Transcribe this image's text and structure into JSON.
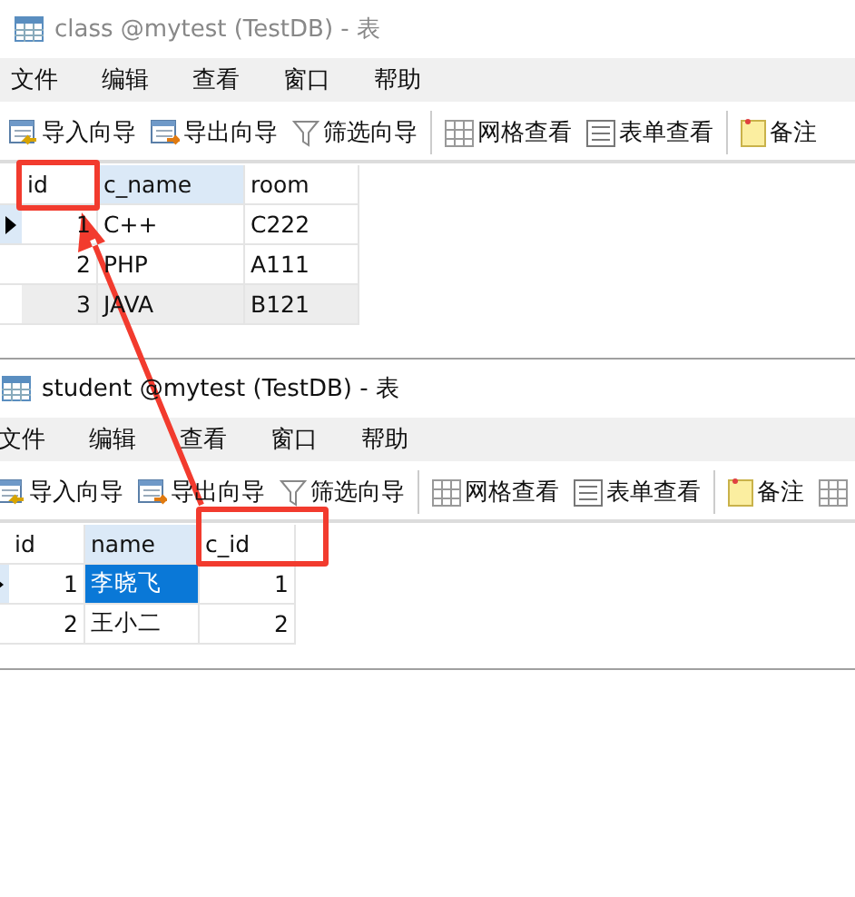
{
  "windows": [
    {
      "title": "class @mytest (TestDB) - 表",
      "shift": false,
      "menu": [
        "文件",
        "编辑",
        "查看",
        "窗口",
        "帮助"
      ],
      "toolbar": [
        {
          "kind": "import",
          "label": "导入向导"
        },
        {
          "kind": "export",
          "label": "导出向导"
        },
        {
          "kind": "filter",
          "label": "筛选向导"
        },
        {
          "kind": "separator"
        },
        {
          "kind": "grid",
          "label": "网格查看"
        },
        {
          "kind": "form",
          "label": "表单查看"
        },
        {
          "kind": "separator"
        },
        {
          "kind": "note",
          "label": "备注"
        }
      ],
      "columns": [
        {
          "label": "id",
          "numeric": true,
          "selected": false
        },
        {
          "label": "c_name",
          "numeric": false,
          "selected": true
        },
        {
          "label": "room",
          "numeric": false,
          "selected": false
        }
      ],
      "rows": [
        {
          "current": true,
          "hovered": false,
          "cells": [
            {
              "text": "1",
              "selected": false
            },
            {
              "text": "C++",
              "selected": false
            },
            {
              "text": "C222",
              "selected": false
            }
          ]
        },
        {
          "current": false,
          "hovered": false,
          "cells": [
            {
              "text": "2",
              "selected": false
            },
            {
              "text": "PHP",
              "selected": false
            },
            {
              "text": "A111",
              "selected": false
            }
          ]
        },
        {
          "current": false,
          "hovered": true,
          "cells": [
            {
              "text": "3",
              "selected": false
            },
            {
              "text": "JAVA",
              "selected": false
            },
            {
              "text": "B121",
              "selected": false
            }
          ]
        }
      ]
    },
    {
      "title": "student @mytest (TestDB) - 表",
      "shift": true,
      "menu": [
        "文件",
        "编辑",
        "查看",
        "窗口",
        "帮助"
      ],
      "toolbar": [
        {
          "kind": "import",
          "label": "导入向导"
        },
        {
          "kind": "export",
          "label": "导出向导"
        },
        {
          "kind": "filter",
          "label": "筛选向导"
        },
        {
          "kind": "separator"
        },
        {
          "kind": "grid",
          "label": "网格查看"
        },
        {
          "kind": "form",
          "label": "表单查看"
        },
        {
          "kind": "separator"
        },
        {
          "kind": "note",
          "label": "备注"
        },
        {
          "kind": "grid"
        }
      ],
      "columns": [
        {
          "label": "id",
          "numeric": true,
          "selected": false
        },
        {
          "label": "name",
          "numeric": false,
          "selected": true
        },
        {
          "label": "c_id",
          "numeric": true,
          "selected": false
        }
      ],
      "rows": [
        {
          "current": true,
          "hovered": false,
          "cells": [
            {
              "text": "1",
              "selected": false
            },
            {
              "text": "李晓飞",
              "selected": true
            },
            {
              "text": "1",
              "selected": false
            }
          ]
        },
        {
          "current": false,
          "hovered": false,
          "cells": [
            {
              "text": "2",
              "selected": false
            },
            {
              "text": "王小二",
              "selected": false
            },
            {
              "text": "2",
              "selected": false
            }
          ]
        }
      ]
    }
  ],
  "annotations": [
    {
      "kind": "box"
    },
    {
      "kind": "box"
    },
    {
      "kind": "arrow"
    }
  ]
}
